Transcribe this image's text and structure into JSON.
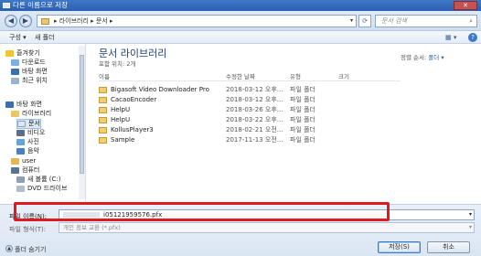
{
  "window": {
    "title": "다른 이름으로 저장",
    "close": "✕"
  },
  "nav": {
    "back": "◀",
    "forward": "▶",
    "path": "▸ 라이브러리 ▸ 문서 ▸",
    "search_placeholder": "문서 검색",
    "refresh": "⟳"
  },
  "toolbar": {
    "organize": "구성 ▾",
    "new_folder": "새 폴더",
    "view": "▦ ▾",
    "help": "?"
  },
  "sidebar": {
    "items": [
      {
        "label": "즐겨찾기",
        "icon": "star-icon"
      },
      {
        "label": "다운로드",
        "icon": "download-icon"
      },
      {
        "label": "바탕 화면",
        "icon": "desktop-icon"
      },
      {
        "label": "최근 위치",
        "icon": "recent-icon"
      },
      {
        "label": "바탕 화면",
        "icon": "desktop-icon"
      },
      {
        "label": "라이브러리",
        "icon": "library-icon"
      },
      {
        "label": "문서",
        "icon": "documents-icon"
      },
      {
        "label": "비디오",
        "icon": "video-icon"
      },
      {
        "label": "사진",
        "icon": "pictures-icon"
      },
      {
        "label": "음악",
        "icon": "music-icon"
      },
      {
        "label": "user",
        "icon": "user-icon"
      },
      {
        "label": "컴퓨터",
        "icon": "computer-icon"
      },
      {
        "label": "새 볼륨 (C:)",
        "icon": "drive-icon"
      },
      {
        "label": "DVD 드라이브",
        "icon": "dvd-icon"
      }
    ]
  },
  "library": {
    "title": "문서 라이브러리",
    "subtitle": "포함 위치: 2개",
    "sort_label": "정렬 순서:",
    "sort_value": "폴더 ▾"
  },
  "columns": {
    "name": "이름",
    "date": "수정한 날짜",
    "type": "유형",
    "size": "크기"
  },
  "files": [
    {
      "name": "Bigasoft Video Downloader Pro",
      "date": "2018-03-12 오후...",
      "type": "파일 폴더"
    },
    {
      "name": "CacaoEncoder",
      "date": "2018-03-12 오후...",
      "type": "파일 폴더"
    },
    {
      "name": "HelpU",
      "date": "2018-03-26 오후...",
      "type": "파일 폴더"
    },
    {
      "name": "HelpU",
      "date": "2018-03-22 오후...",
      "type": "파일 폴더"
    },
    {
      "name": "KollusPlayer3",
      "date": "2018-02-21 오전...",
      "type": "파일 폴더"
    },
    {
      "name": "Sample",
      "date": "2017-11-13 오전...",
      "type": "파일 폴더"
    }
  ],
  "form": {
    "filename_label": "파일 이름(N):",
    "filename_value": "i05121959576.pfx",
    "filetype_label": "파일 형식(T):",
    "filetype_value": "개인 정보 교환 (*.pfx)",
    "dropdown": "▾"
  },
  "footer": {
    "hide_folders": "폴더 숨기기",
    "save": "저장(S)",
    "cancel": "취소"
  },
  "colors": {
    "highlight": "#e0191f",
    "title_bar": "#2c5fae"
  }
}
